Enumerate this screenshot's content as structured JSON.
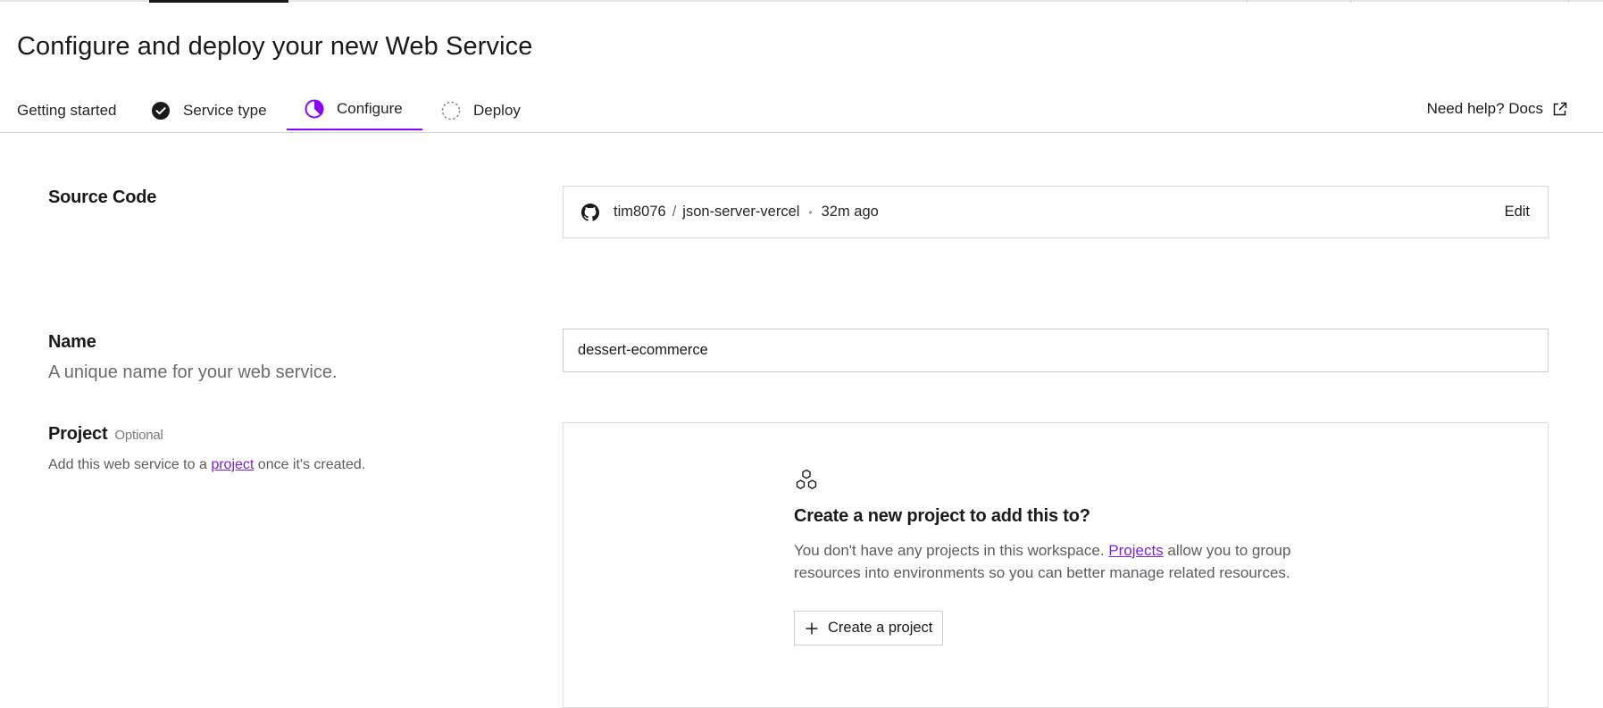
{
  "page": {
    "title": "Configure and deploy your new Web Service"
  },
  "tabs": [
    {
      "label": "Getting started",
      "state": "default"
    },
    {
      "label": "Service type",
      "state": "complete",
      "icon": "check-circle-icon"
    },
    {
      "label": "Configure",
      "state": "active",
      "icon": "progress-circle-icon"
    },
    {
      "label": "Deploy",
      "state": "pending",
      "icon": "dashed-circle-icon"
    }
  ],
  "help": {
    "label": "Need help? Docs",
    "icon": "external-link-icon"
  },
  "source_code": {
    "label": "Source Code",
    "owner": "tim8076",
    "separator": "/",
    "repo": "json-server-vercel",
    "bullet": "•",
    "time": "32m ago",
    "edit_label": "Edit",
    "icon": "github-icon"
  },
  "name": {
    "label": "Name",
    "description": "A unique name for your web service.",
    "value": "dessert-ecommerce"
  },
  "project": {
    "label": "Project",
    "optional": "Optional",
    "desc_before": "Add this web service to a ",
    "desc_link": "project",
    "desc_after": " once it's created.",
    "empty_icon": "hexagons-icon",
    "empty_title": "Create a new project to add this to?",
    "empty_text_before": "You don't have any projects in this workspace. ",
    "empty_text_link": "Projects",
    "empty_text_after": " allow you to group resources into environments so you can better manage related resources.",
    "create_button": "Create a project"
  },
  "colors": {
    "accent": "#8a05ff",
    "link": "#7b1fe8",
    "text": "#1a1a1a",
    "muted": "#6b6b6b",
    "border": "#d9d9d9"
  }
}
